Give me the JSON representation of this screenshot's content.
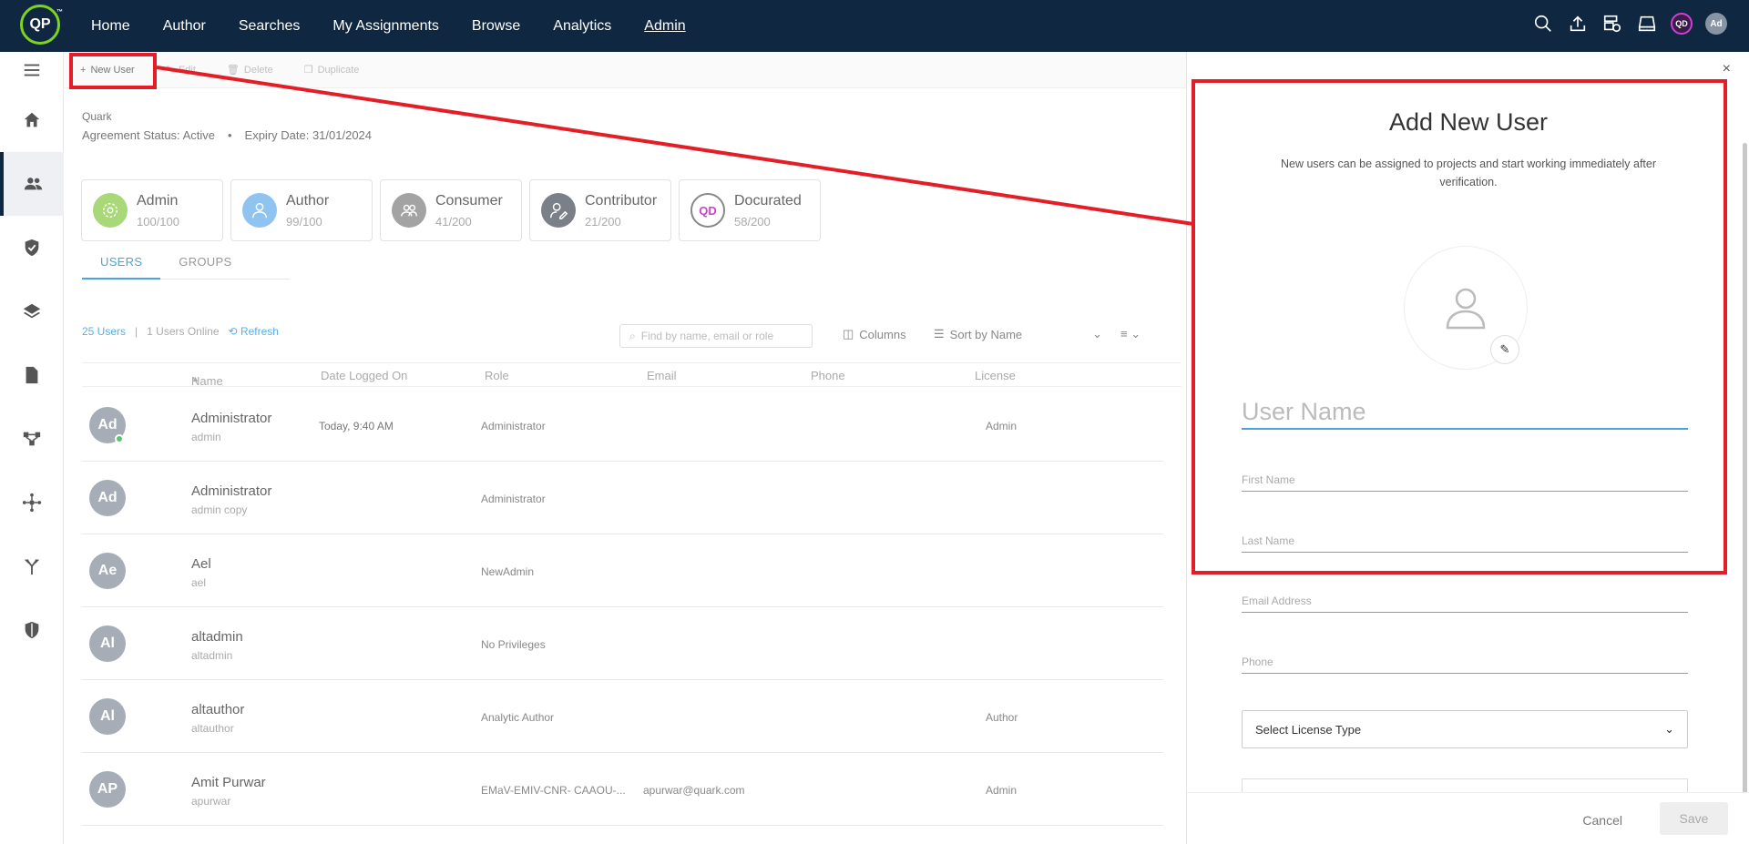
{
  "nav": {
    "logo": "QP",
    "logo_tm": "™",
    "items": [
      "Home",
      "Author",
      "Searches",
      "My Assignments",
      "Browse",
      "Analytics",
      "Admin"
    ],
    "qd_badge": "QD",
    "user_badge": "Ad"
  },
  "toolbar": {
    "new_user": "New User",
    "edit": "Edit",
    "delete": "Delete",
    "duplicate": "Duplicate"
  },
  "org": {
    "name": "Quark",
    "agreement": "Agreement Status: Active",
    "separator": "•",
    "expiry": "Expiry Date: 31/01/2024"
  },
  "licenses": [
    {
      "name": "Admin",
      "count": "100/100",
      "color": "#a8d877"
    },
    {
      "name": "Author",
      "count": "99/100",
      "color": "#8fc3f0"
    },
    {
      "name": "Consumer",
      "count": "41/200",
      "color": "#a3a3a3"
    },
    {
      "name": "Contributor",
      "count": "21/200",
      "color": "#7b7f88"
    },
    {
      "name": "Docurated",
      "count": "58/200",
      "color": "#ffffff"
    }
  ],
  "tabs": [
    "USERS",
    "GROUPS"
  ],
  "stats": {
    "users": "25 Users",
    "divider": "|",
    "online": "1 Users Online",
    "refresh": "Refresh"
  },
  "search": {
    "placeholder": "Find by name, email or role"
  },
  "columns_label": "Columns",
  "sort_label": "Sort by Name",
  "table": {
    "headers": [
      "Name",
      "Date Logged On",
      "Role",
      "Email",
      "Phone",
      "License"
    ],
    "rows": [
      {
        "initials": "Ad",
        "name": "Administrator",
        "login": "admin",
        "date": "Today, 9:40 AM",
        "role": "Administrator",
        "email": "",
        "license": "Admin",
        "online": true
      },
      {
        "initials": "Ad",
        "name": "Administrator",
        "login": "admin copy",
        "date": "",
        "role": "Administrator",
        "email": "",
        "license": "",
        "online": false
      },
      {
        "initials": "Ae",
        "name": "Ael",
        "login": "ael",
        "date": "",
        "role": "NewAdmin",
        "email": "",
        "license": "",
        "online": false
      },
      {
        "initials": "Al",
        "name": "altadmin",
        "login": "altadmin",
        "date": "",
        "role": "No Privileges",
        "email": "",
        "license": "",
        "online": false
      },
      {
        "initials": "Al",
        "name": "altauthor",
        "login": "altauthor",
        "date": "",
        "role": "Analytic Author",
        "email": "",
        "license": "Author",
        "online": false
      },
      {
        "initials": "AP",
        "name": "Amit Purwar",
        "login": "apurwar",
        "date": "",
        "role": "EMaV-EMIV-CNR- CAAOU-...",
        "email": "apurwar@quark.com",
        "license": "Admin",
        "online": false
      }
    ]
  },
  "panel": {
    "close": "×",
    "title": "Add New User",
    "subtitle": "New users can be assigned to projects and start working immediately after verification.",
    "username_placeholder": "User Name",
    "first_name": "First Name",
    "last_name": "Last Name",
    "email": "Email Address",
    "phone": "Phone",
    "license_select": "Select License Type",
    "cancel": "Cancel",
    "save": "Save"
  },
  "colors": {
    "topbar": "#0f2740",
    "accent": "#4aa3df",
    "highlight": "#e41e26"
  }
}
